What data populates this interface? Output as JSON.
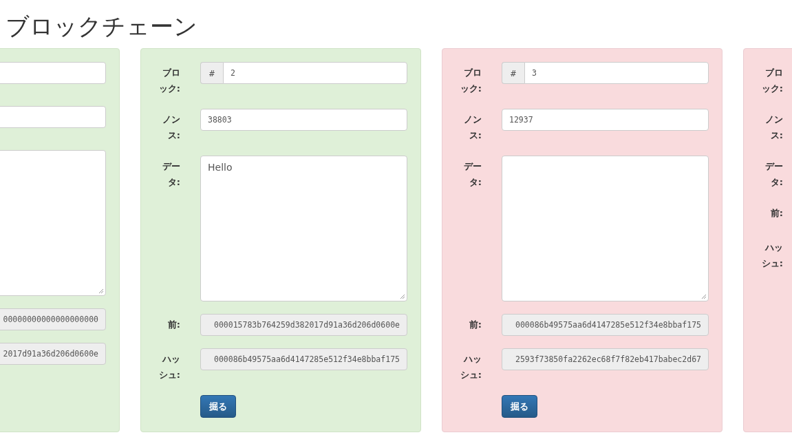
{
  "title": "ブロックチェーン",
  "blocks": [
    {
      "valid": true,
      "fields_shown": true,
      "prev": "00000000000000000000",
      "hash": "2017d91a36d206d0600e"
    },
    {
      "valid": true,
      "fields_shown": true,
      "labels": {
        "block": "ブロック:",
        "nonce": "ノンス:",
        "data": "データ:",
        "prev": "前:",
        "hash": "ハッシュ:"
      },
      "number_prefix": "#",
      "number": "2",
      "nonce": "38803",
      "data": "Hello",
      "prev": "000015783b764259d382017d91a36d206d0600e",
      "hash": "000086b49575aa6d4147285e512f34e8bbaf175",
      "button": "掘る"
    },
    {
      "valid": false,
      "fields_shown": true,
      "labels": {
        "block": "ブロック:",
        "nonce": "ノンス:",
        "data": "データ:",
        "prev": "前:",
        "hash": "ハッシュ:"
      },
      "number_prefix": "#",
      "number": "3",
      "nonce": "12937",
      "prev": "000086b49575aa6d4147285e512f34e8bbaf175",
      "hash": "2593f73850fa2262ec68f7f82eb417babec2d67",
      "button": "掘る"
    },
    {
      "valid": false,
      "fields_shown": false,
      "labels": {
        "block": "ブロック:",
        "nonce": "ノンス:",
        "data": "データ:",
        "prev": "前:",
        "hash": "ハッシュ:"
      }
    }
  ]
}
